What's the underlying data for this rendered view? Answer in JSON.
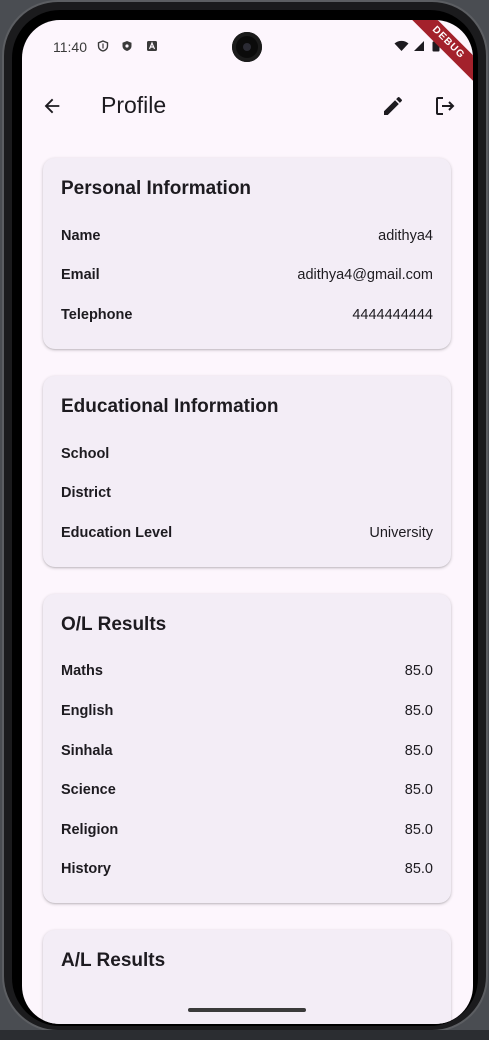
{
  "status_bar": {
    "time": "11:40"
  },
  "debug_banner": "DEBUG",
  "app_bar": {
    "title": "Profile"
  },
  "sections": [
    {
      "title": "Personal Information",
      "rows": [
        {
          "label": "Name",
          "value": "adithya4"
        },
        {
          "label": "Email",
          "value": "adithya4@gmail.com"
        },
        {
          "label": "Telephone",
          "value": "4444444444"
        }
      ]
    },
    {
      "title": "Educational Information",
      "rows": [
        {
          "label": "School",
          "value": ""
        },
        {
          "label": "District",
          "value": ""
        },
        {
          "label": "Education Level",
          "value": "University"
        }
      ]
    },
    {
      "title": "O/L Results",
      "rows": [
        {
          "label": "Maths",
          "value": "85.0"
        },
        {
          "label": "English",
          "value": "85.0"
        },
        {
          "label": "Sinhala",
          "value": "85.0"
        },
        {
          "label": "Science",
          "value": "85.0"
        },
        {
          "label": "Religion",
          "value": "85.0"
        },
        {
          "label": "History",
          "value": "85.0"
        }
      ]
    },
    {
      "title": "A/L Results",
      "rows": []
    }
  ],
  "colors": {
    "background": "#fdf6fd",
    "card": "#f3edf6",
    "text": "#1d1b20",
    "debug_ribbon": "#a3212b"
  },
  "icons": {
    "back": "arrow-back-icon",
    "edit": "pencil-icon",
    "logout": "logout-icon"
  }
}
